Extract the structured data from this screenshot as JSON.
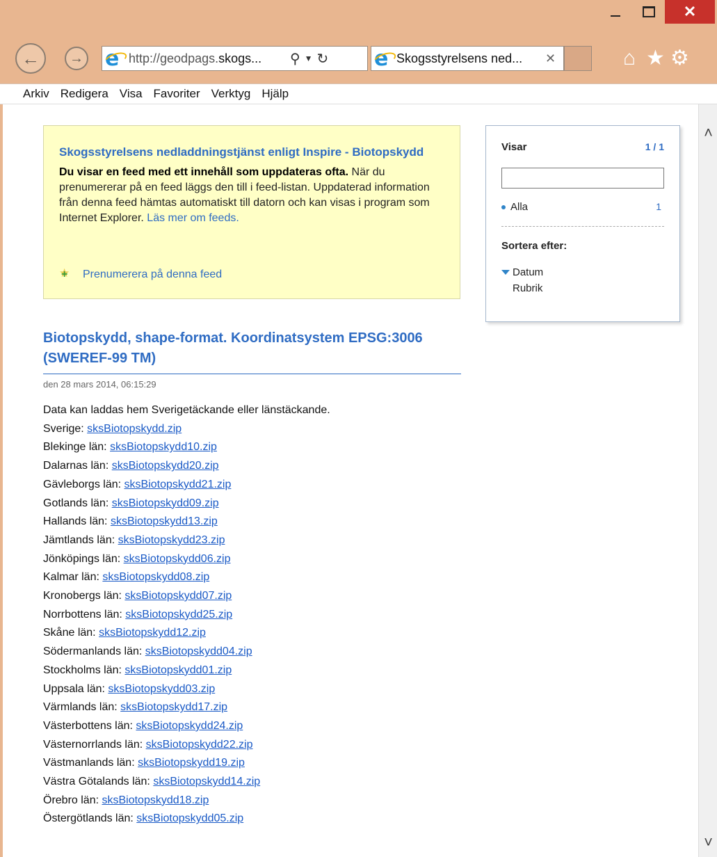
{
  "window": {
    "minimize_glyph": "_",
    "close_glyph": "✕"
  },
  "nav": {
    "address_prefix": "http://geodpags.",
    "address_bold": "skogs...",
    "tab_title": "Skogsstyrelsens ned...",
    "tab_close": "✕"
  },
  "menu": [
    "Arkiv",
    "Redigera",
    "Visa",
    "Favoriter",
    "Verktyg",
    "Hjälp"
  ],
  "feed": {
    "title": "Skogsstyrelsens nedladdningstjänst enligt Inspire - Biotopskydd",
    "desc_bold": "Du visar en feed med ett innehåll som uppdateras ofta.",
    "desc_rest": " När du prenumererar på en feed läggs den till i feed-listan. Uppdaterad information från denna feed hämtas automatiskt till datorn och kan visas i program som Internet Explorer. ",
    "desc_link": "Läs mer om feeds.",
    "subscribe": "Prenumerera på denna feed"
  },
  "sidebar": {
    "label": "Visar",
    "count": "1 / 1",
    "filter_value": "",
    "all_label": "Alla",
    "all_count": "1",
    "sort_label": "Sortera efter:",
    "sort_option_1": "Datum",
    "sort_option_2": "Rubrik"
  },
  "entry": {
    "title": "Biotopskydd, shape-format. Koordinatsystem EPSG:3006 (SWEREF-99 TM)",
    "date": "den 28 mars 2014, 06:15:29",
    "intro": "Data kan laddas hem Sverigetäckande eller länstäckande.",
    "downloads": [
      {
        "label": "Sverige: ",
        "file": "sksBiotopskydd.zip"
      },
      {
        "label": "Blekinge län: ",
        "file": "sksBiotopskydd10.zip"
      },
      {
        "label": "Dalarnas län: ",
        "file": "sksBiotopskydd20.zip"
      },
      {
        "label": "Gävleborgs län: ",
        "file": "sksBiotopskydd21.zip"
      },
      {
        "label": "Gotlands län: ",
        "file": "sksBiotopskydd09.zip"
      },
      {
        "label": "Hallands län: ",
        "file": "sksBiotopskydd13.zip"
      },
      {
        "label": "Jämtlands län: ",
        "file": "sksBiotopskydd23.zip"
      },
      {
        "label": "Jönköpings län: ",
        "file": "sksBiotopskydd06.zip"
      },
      {
        "label": "Kalmar län: ",
        "file": "sksBiotopskydd08.zip"
      },
      {
        "label": "Kronobergs län: ",
        "file": "sksBiotopskydd07.zip"
      },
      {
        "label": "Norrbottens län: ",
        "file": "sksBiotopskydd25.zip"
      },
      {
        "label": "Skåne län: ",
        "file": "sksBiotopskydd12.zip"
      },
      {
        "label": "Södermanlands län: ",
        "file": "sksBiotopskydd04.zip"
      },
      {
        "label": "Stockholms län: ",
        "file": "sksBiotopskydd01.zip"
      },
      {
        "label": "Uppsala län: ",
        "file": "sksBiotopskydd03.zip"
      },
      {
        "label": "Värmlands län: ",
        "file": "sksBiotopskydd17.zip"
      },
      {
        "label": "Västerbottens län: ",
        "file": "sksBiotopskydd24.zip"
      },
      {
        "label": "Västernorrlands län: ",
        "file": "sksBiotopskydd22.zip"
      },
      {
        "label": "Västmanlands län: ",
        "file": "sksBiotopskydd19.zip"
      },
      {
        "label": "Västra Götalands län: ",
        "file": "sksBiotopskydd14.zip"
      },
      {
        "label": "Örebro län: ",
        "file": "sksBiotopskydd18.zip"
      },
      {
        "label": "Östergötlands län: ",
        "file": "sksBiotopskydd05.zip"
      }
    ]
  },
  "icons": {
    "back": "back-arrow-icon",
    "forward": "forward-arrow-icon",
    "search": "search-icon",
    "refresh": "refresh-icon",
    "home": "home-icon",
    "favorites": "star-icon",
    "settings": "gear-icon"
  },
  "colors": {
    "frame": "#e8b690",
    "close_button": "#c7312b",
    "link": "#2f6cc3",
    "feed_box": "#ffffc6"
  }
}
